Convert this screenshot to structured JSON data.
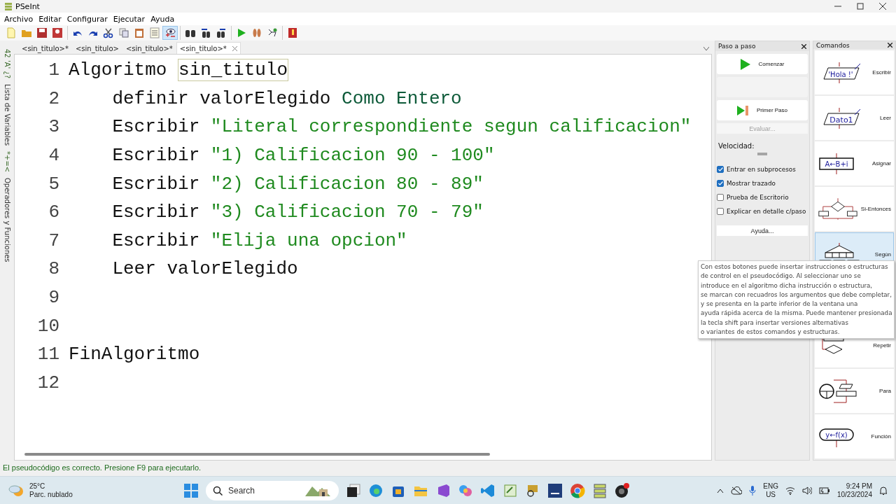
{
  "window": {
    "title": "PSeInt"
  },
  "menu": [
    "Archivo",
    "Editar",
    "Configurar",
    "Ejecutar",
    "Ayuda"
  ],
  "toolbar": [
    [
      {
        "kind": "new",
        "selected": false
      },
      {
        "kind": "open",
        "selected": false
      },
      {
        "kind": "save",
        "selected": false
      },
      {
        "kind": "save_as",
        "selected": false
      }
    ],
    [
      {
        "kind": "undo",
        "selected": false
      },
      {
        "kind": "redo",
        "selected": false
      },
      {
        "kind": "cut",
        "selected": false
      },
      {
        "kind": "copy",
        "selected": false
      },
      {
        "kind": "paste",
        "selected": false
      },
      {
        "kind": "indent",
        "selected": false
      },
      {
        "kind": "watch",
        "selected": true
      }
    ],
    [
      {
        "kind": "find",
        "selected": false
      },
      {
        "kind": "find_prev",
        "selected": false
      },
      {
        "kind": "find_next",
        "selected": false
      }
    ],
    [
      {
        "kind": "run",
        "selected": false
      },
      {
        "kind": "step",
        "selected": false
      },
      {
        "kind": "flow",
        "selected": false
      }
    ],
    [
      {
        "kind": "help",
        "selected": false
      }
    ]
  ],
  "tabs": [
    {
      "label": "<sin_titulo>*",
      "selected": false
    },
    {
      "label": "<sin_titulo>",
      "selected": false
    },
    {
      "label": "<sin_titulo>*",
      "selected": false
    },
    {
      "label": "<sin_titulo>*",
      "selected": true
    }
  ],
  "side_tabs": [
    {
      "symbols": "42 'A' ¿?",
      "label": "Lista de Variables"
    },
    {
      "symbols": "*+=<",
      "label": "Operadores y Funciones"
    }
  ],
  "editor": {
    "lines": [
      {
        "number": "1",
        "tokens": [
          {
            "kind": "keyword",
            "text": "Algoritmo "
          },
          {
            "kind": "boxed",
            "text": "sin_titulo"
          }
        ]
      },
      {
        "number": "2",
        "tokens": [
          {
            "kind": "keyword",
            "text": "    definir "
          },
          {
            "kind": "ident",
            "text": "valorElegido "
          },
          {
            "kind": "type",
            "text": "Como Entero"
          }
        ]
      },
      {
        "number": "3",
        "tokens": [
          {
            "kind": "keyword",
            "text": "    Escribir "
          },
          {
            "kind": "string",
            "text": "\"Literal correspondiente segun calificacion\""
          }
        ]
      },
      {
        "number": "4",
        "tokens": [
          {
            "kind": "keyword",
            "text": "    Escribir "
          },
          {
            "kind": "string",
            "text": "\"1) Calificacion 90 - 100\""
          }
        ]
      },
      {
        "number": "5",
        "tokens": [
          {
            "kind": "keyword",
            "text": "    Escribir "
          },
          {
            "kind": "string",
            "text": "\"2) Calificacion 80 - 89\""
          }
        ]
      },
      {
        "number": "6",
        "tokens": [
          {
            "kind": "keyword",
            "text": "    Escribir "
          },
          {
            "kind": "string",
            "text": "\"3) Calificacion 70 - 79\""
          }
        ]
      },
      {
        "number": "7",
        "tokens": [
          {
            "kind": "keyword",
            "text": "    Escribir "
          },
          {
            "kind": "string",
            "text": "\"Elija una opcion\""
          }
        ]
      },
      {
        "number": "8",
        "tokens": [
          {
            "kind": "keyword",
            "text": "    Leer "
          },
          {
            "kind": "ident",
            "text": "valorElegido"
          }
        ]
      },
      {
        "number": "9"
      },
      {
        "number": "10"
      },
      {
        "number": "11",
        "tokens": [
          {
            "kind": "keyword",
            "text": "FinAlgoritmo"
          }
        ]
      },
      {
        "number": "12"
      }
    ]
  },
  "step_panel": {
    "title": "Paso a paso",
    "start": "Comenzar",
    "first_step": "Primer Paso",
    "evaluate": {
      "label": "Evaluar...",
      "disabled": true
    },
    "speed": {
      "label": "Velocidad:",
      "level": 0.5
    },
    "options": [
      {
        "label": "Entrar en subprocesos",
        "checked": true
      },
      {
        "label": "Mostrar trazado",
        "checked": true
      },
      {
        "label": "Prueba de Escritorio",
        "checked": false
      },
      {
        "label": "Explicar en detalle c/paso",
        "checked": false
      }
    ],
    "help": "Ayuda..."
  },
  "commands": {
    "title": "Comandos",
    "items": [
      {
        "kind": "write",
        "label": "Escribir",
        "icon_text": "'Hola !'",
        "selected": false
      },
      {
        "kind": "read",
        "label": "Leer",
        "icon_text": "Dato1",
        "selected": false
      },
      {
        "kind": "assign",
        "label": "Asignar",
        "icon_text": "A←B+i",
        "selected": false
      },
      {
        "kind": "if",
        "label": "Si-Entonces",
        "selected": false
      },
      {
        "kind": "switch",
        "label": "Según",
        "selected": true
      },
      {
        "kind": "repeat",
        "label": "Repetir",
        "selected": false
      },
      {
        "kind": "for",
        "label": "Para",
        "selected": false
      },
      {
        "kind": "function",
        "label": "Función",
        "icon_text": "y←f(x)",
        "selected": false
      }
    ]
  },
  "tooltip": [
    "Con estos botones puede insertar instrucciones o estructuras",
    "de control en el pseudocódigo. Al seleccionar uno se",
    "introduce en el algoritmo dicha instrucción o estructura,",
    "se marcan con recuadros los argumentos que debe completar,",
    "y se presenta en la parte inferior de la ventana una",
    "ayuda rápida acerca de la misma. Puede mantener presionada",
    "la tecla shift para insertar versiones alternativas",
    "o variantes de estos comandos y estructuras."
  ],
  "status_bar": "El pseudocódigo es correcto. Presione F9 para ejecutarlo.",
  "taskbar": {
    "temperature": "25°C",
    "weather": "Parc. nublado",
    "search": "Search",
    "language": "ENG",
    "region": "US",
    "time": "9:24 PM",
    "date": "10/23/2024"
  }
}
